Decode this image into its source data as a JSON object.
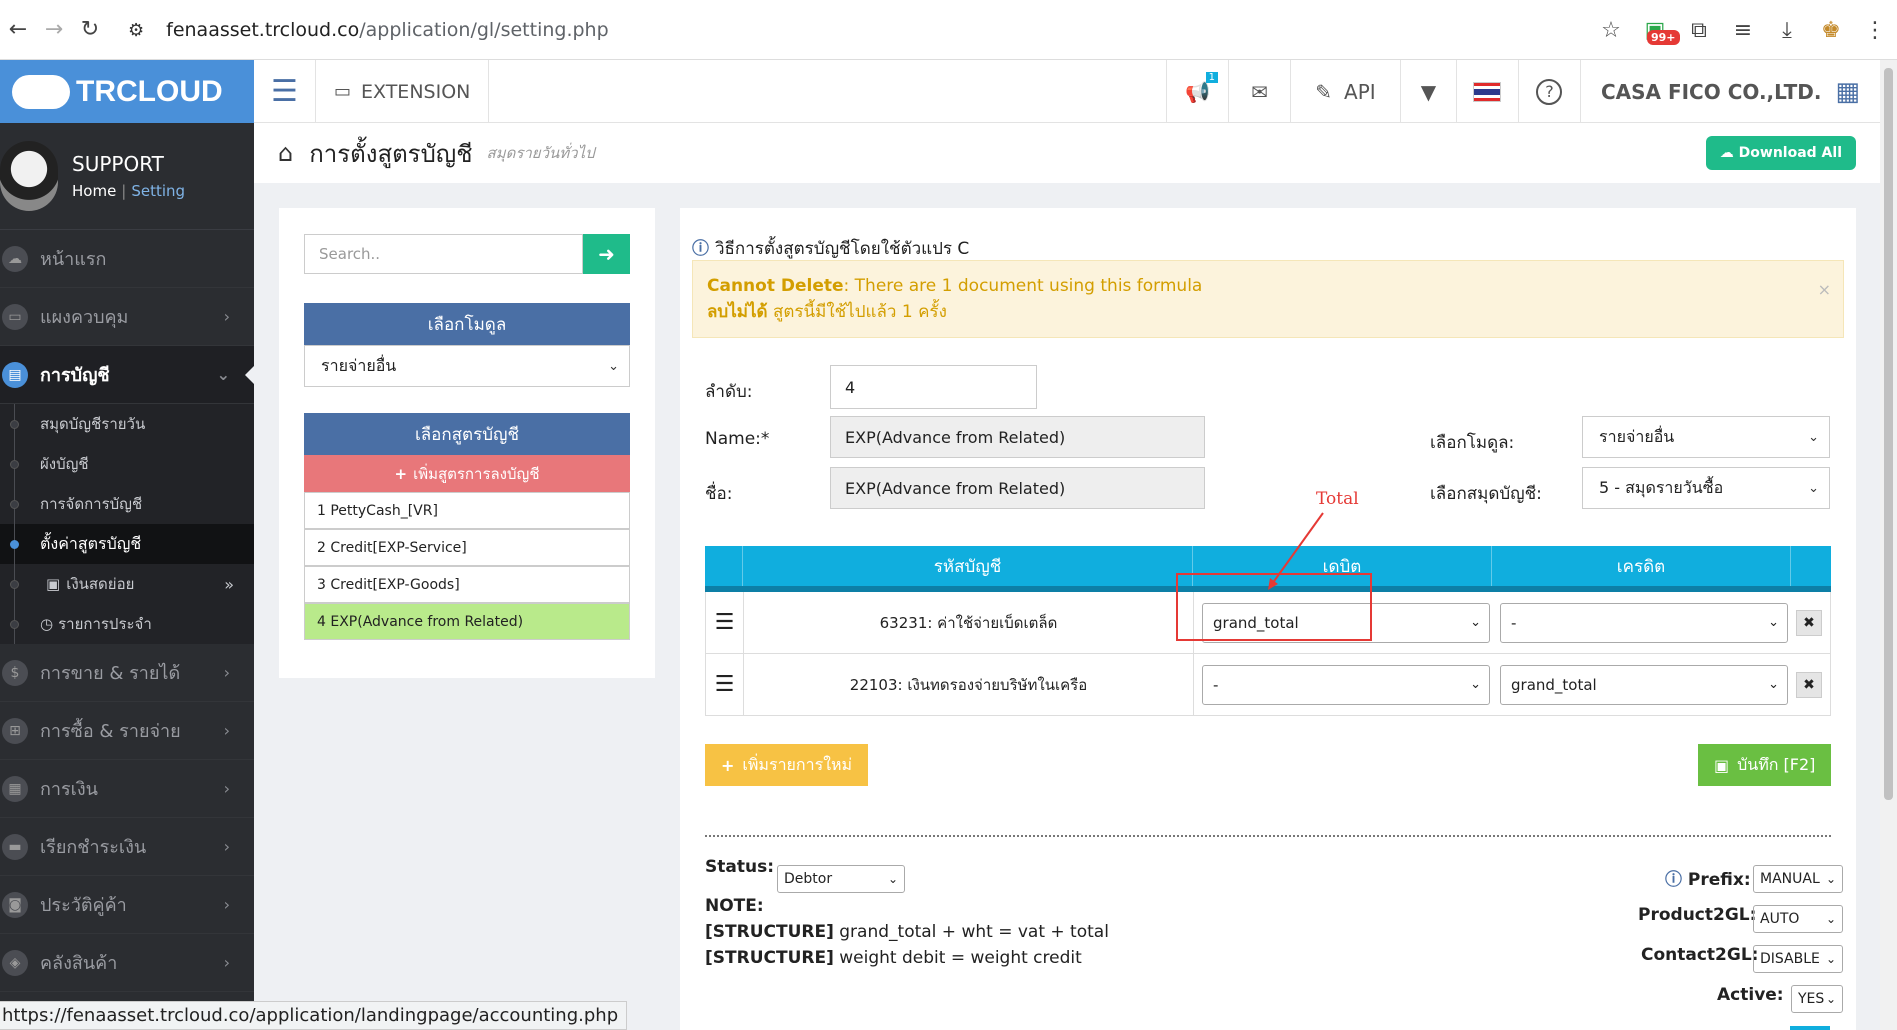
{
  "browser": {
    "url_host": "fenaasset.trcloud.co",
    "url_path": "/application/gl/setting.php",
    "ext_badge": "99+",
    "status_url": "https://fenaasset.trcloud.co/application/landingpage/accounting.php"
  },
  "header": {
    "brand": "TRCLOUD",
    "extension": "EXTENSION",
    "api": "API",
    "notif_badge": "1",
    "company": "CASA FICO CO.,LTD."
  },
  "sidebar": {
    "user": "SUPPORT",
    "crumb_home": "Home",
    "crumb_sep": "|",
    "crumb_current": "Setting",
    "items": [
      {
        "label": "หน้าแรก"
      },
      {
        "label": "แผงควบคุม"
      },
      {
        "label": "การบัญชี"
      },
      {
        "label": "การขาย & รายได้"
      },
      {
        "label": "การซื้อ & รายจ่าย"
      },
      {
        "label": "การเงิน"
      },
      {
        "label": "เรียกชำระเงิน"
      },
      {
        "label": "ประวัติคู่ค้า"
      },
      {
        "label": "คลังสินค้า"
      }
    ],
    "sub_items": [
      {
        "label": "สมุดบัญชีรายวัน"
      },
      {
        "label": "ผังบัญชี"
      },
      {
        "label": "การจัดการบัญชี"
      },
      {
        "label": "ตั้งค่าสูตรบัญชี"
      },
      {
        "label": "เงินสดย่อย"
      },
      {
        "label": "รายการประจำ"
      }
    ]
  },
  "page": {
    "title": "การตั้งสูตรบัญชี",
    "subtitle": "สมุดรายวันทั่วไป",
    "download_all": "Download All"
  },
  "left": {
    "search_placeholder": "Search..",
    "module_head": "เลือกโมดูล",
    "module_value": "รายจ่ายอื่น",
    "formula_head": "เลือกสูตรบัญชี",
    "add_formula": "เพิ่มสูตรการลงบัญชี",
    "formulas": [
      {
        "label": "1 PettyCash_[VR]"
      },
      {
        "label": "2 Credit[EXP-Service]"
      },
      {
        "label": "3 Credit[EXP-Goods]"
      },
      {
        "label": "4 EXP(Advance from Related)"
      }
    ]
  },
  "form": {
    "info": "วิธีการตั้งสูตรบัญชีโดยใช้ตัวแปร C",
    "alert_en_b": "Cannot Delete",
    "alert_en": ": There are 1 document using this formula",
    "alert_th_b": "ลบไม่ได้",
    "alert_th": " สูตรนี้มีใช้ไปแล้ว 1 ครั้ง",
    "alert_close": "×",
    "order_label": "ลำดับ:",
    "order_value": "4",
    "name_label": "Name:*",
    "name_value": "EXP(Advance from Related)",
    "thai_name_label": "ชื่อ:",
    "thai_name_value": "EXP(Advance from Related)",
    "module_label": "เลือกโมดูล:",
    "module_value": "รายจ่ายอื่น",
    "journal_label": "เลือกสมุดบัญชี:",
    "journal_value": "5 - สมุดรายวันซื้อ"
  },
  "grid": {
    "col_account": "รหัสบัญชี",
    "col_debit": "เดบิต",
    "col_credit": "เครดิต",
    "rows": [
      {
        "account": "63231: ค่าใช้จ่ายเบ็ดเตล็ด",
        "debit": "grand_total",
        "credit": "-"
      },
      {
        "account": "22103: เงินทดรองจ่ายบริษัทในเครือ",
        "debit": "-",
        "credit": "grand_total"
      }
    ]
  },
  "actions": {
    "add_row": "เพิ่มรายการใหม่",
    "save": "บันทึก [F2]"
  },
  "bottom": {
    "status_label": "Status:",
    "status_value": "Debtor",
    "note": "NOTE:",
    "struct1_b": "[STRUCTURE]",
    "struct1": " grand_total + wht = vat + total",
    "struct2_b": "[STRUCTURE]",
    "struct2": " weight debit = weight credit",
    "prefix_label": "Prefix:",
    "prefix_value": "MANUAL",
    "product_label": "Product2GL:",
    "product_value": "AUTO",
    "contact_label": "Contact2GL:",
    "contact_value": "DISABLE",
    "active_label": "Active:",
    "active_value": "YES"
  },
  "annotation": {
    "text": "Total",
    "color": "#e53935"
  }
}
